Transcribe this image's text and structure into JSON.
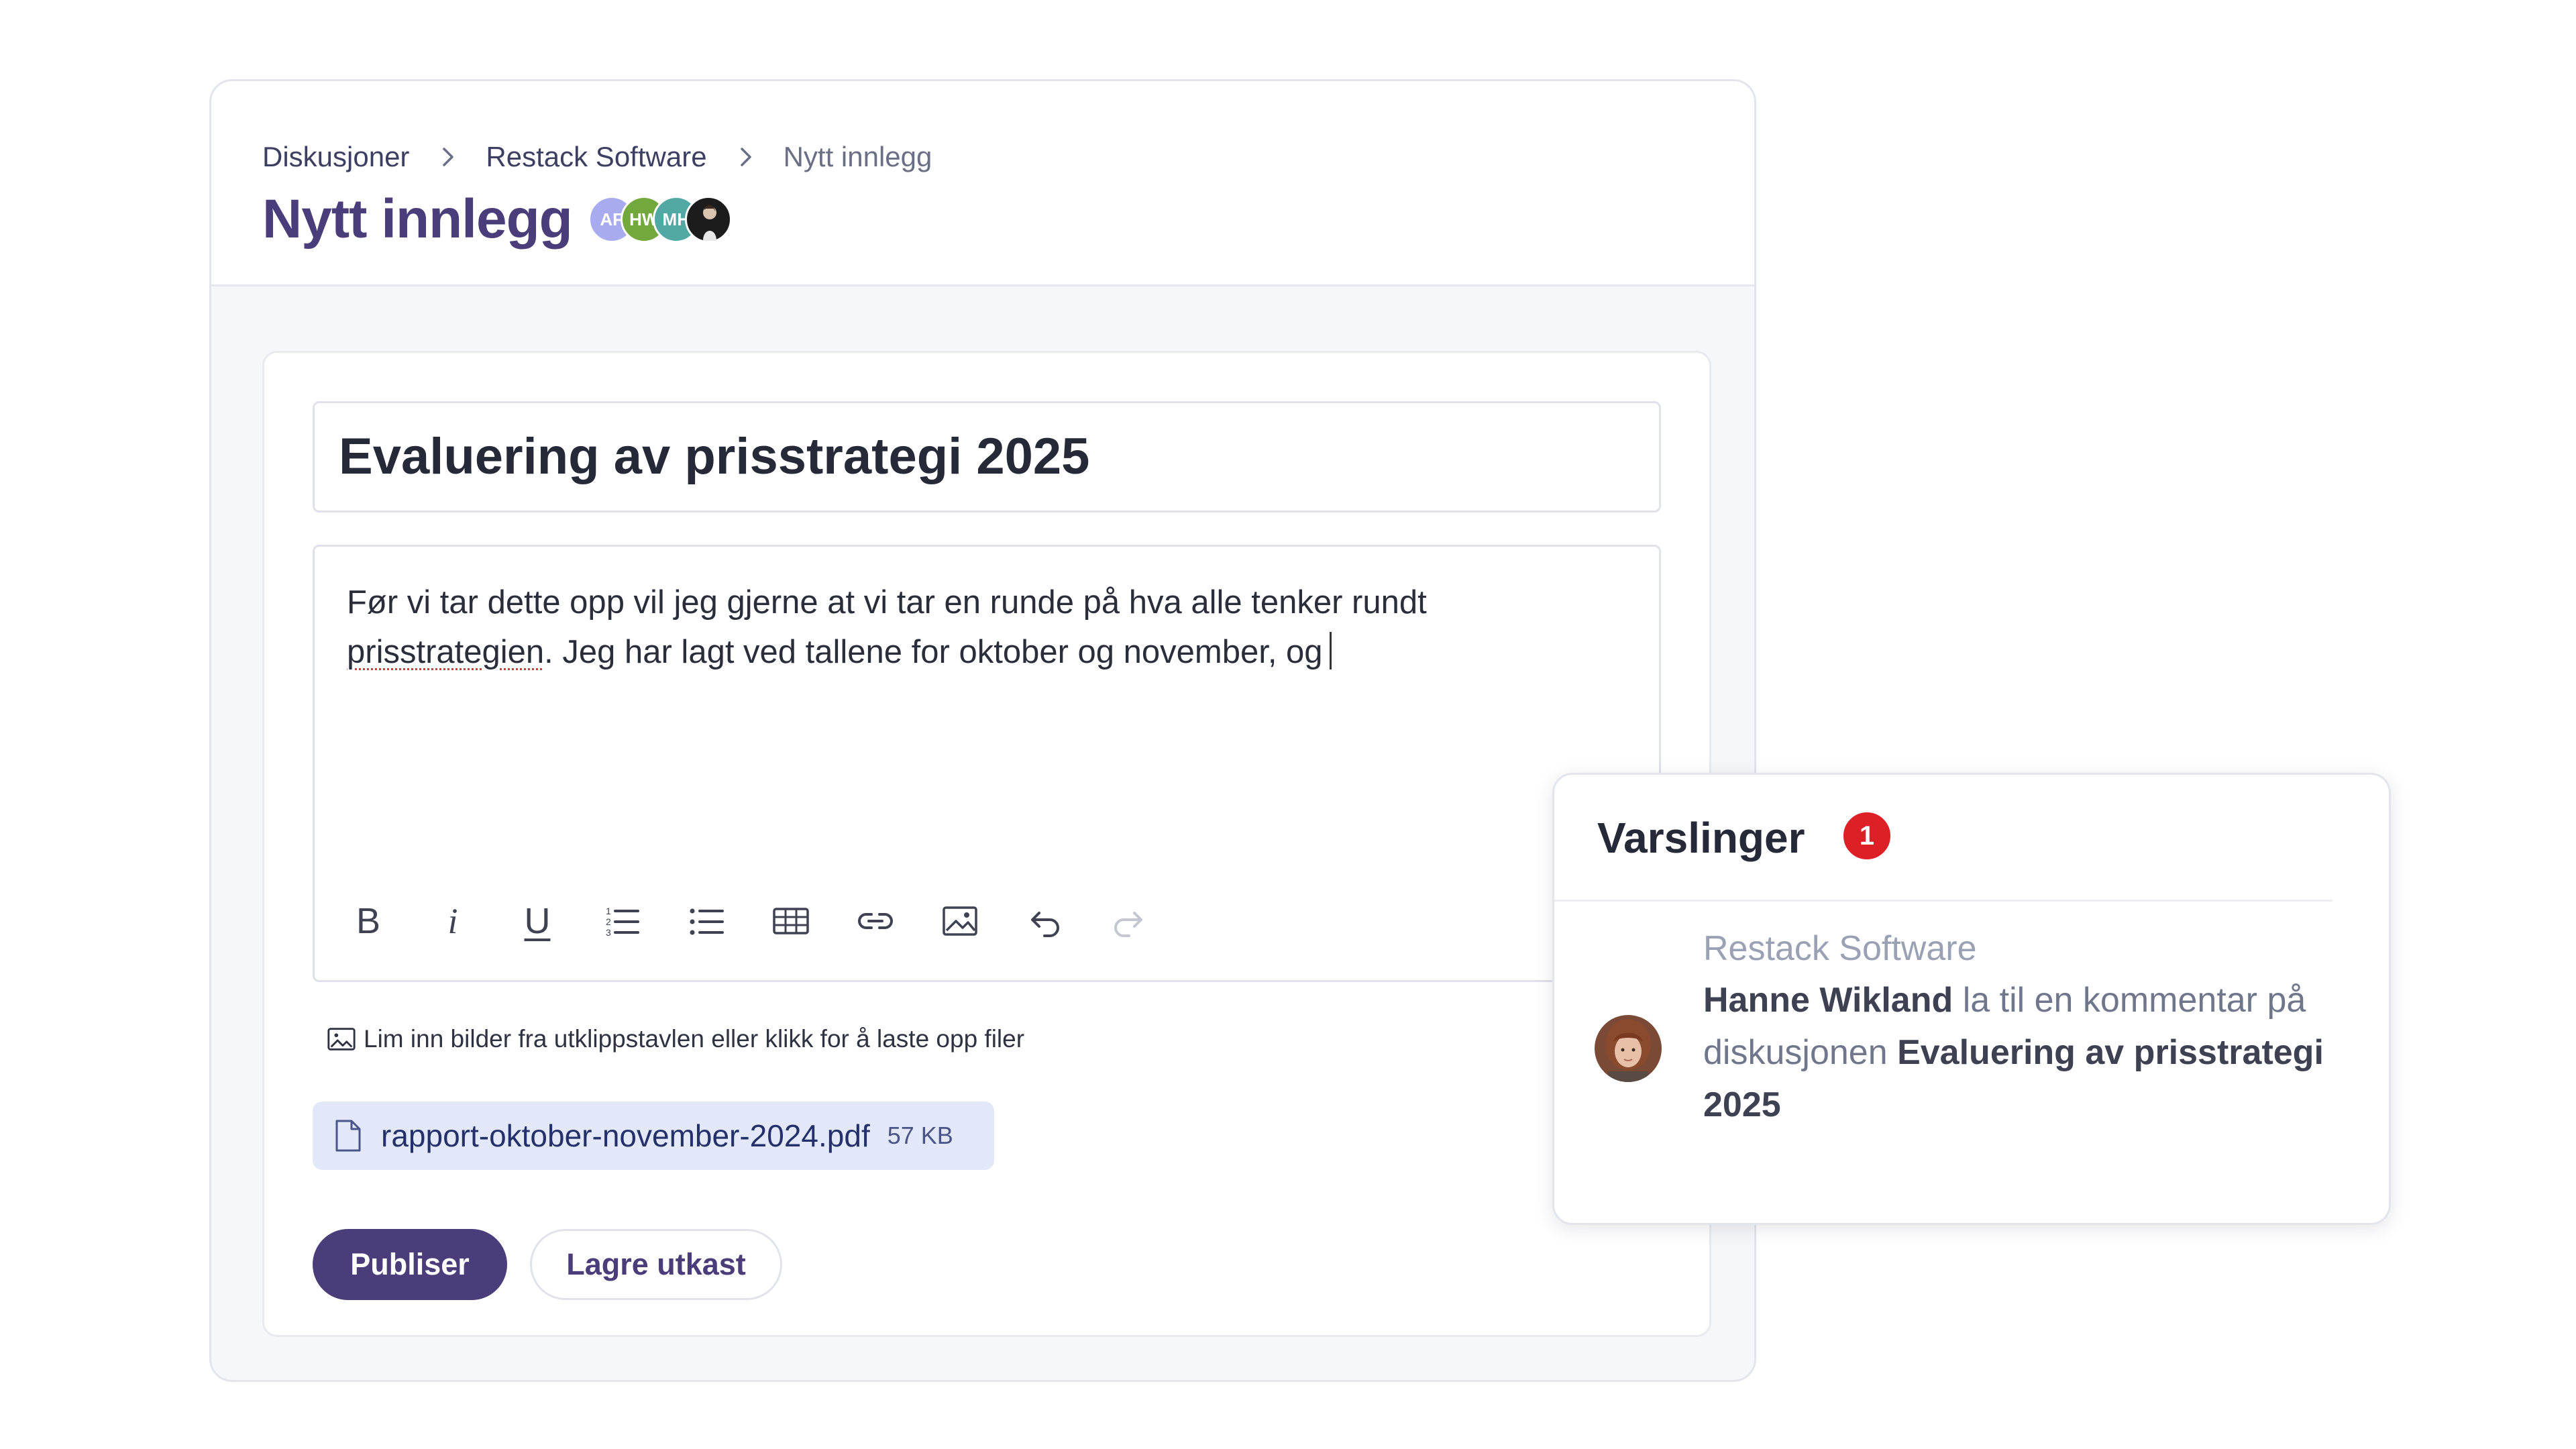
{
  "breadcrumb": {
    "items": [
      "Diskusjoner",
      "Restack Software",
      "Nytt innlegg"
    ]
  },
  "header": {
    "title": "Nytt innlegg",
    "avatars": [
      {
        "initials": "AF",
        "color": "#a8abf0"
      },
      {
        "initials": "HW",
        "color": "#73a83c"
      },
      {
        "initials": "MH",
        "color": "#52a9a3"
      },
      {
        "initials": "",
        "color": "#1c1c1c"
      }
    ]
  },
  "editor": {
    "title_value": "Evaluering av prisstrategi 2025",
    "body_before": "Før vi tar dette opp vil jeg gjerne at vi tar en runde på hva alle tenker rundt ",
    "body_misspelled": "prisstrategien",
    "body_after": ". Jeg har lagt ved tallene for oktober og november, og",
    "toolbar": {
      "bold": "B",
      "italic": "i",
      "underline": "U",
      "icons": [
        "ordered-list-icon",
        "bullet-list-icon",
        "table-icon",
        "link-icon",
        "image-icon",
        "undo-icon",
        "redo-icon"
      ]
    },
    "upload_hint": "Lim inn bilder fra utklippstavlen eller klikk for å laste opp filer",
    "attachment": {
      "filename": "rapport-oktober-november-2024.pdf",
      "size": "57 KB"
    },
    "publish_label": "Publiser",
    "draft_label": "Lagre utkast"
  },
  "notifications": {
    "title": "Varslinger",
    "count": "1",
    "badge_color": "#dd1f26",
    "item": {
      "source": "Restack Software",
      "author": "Hanne Wikland",
      "action": " la til en kommentar på diskusjonen ",
      "discussion": "Evaluering av prisstrategi 2025"
    }
  },
  "colors": {
    "accent": "#4a3d7a",
    "attachment_bg": "#e2e8f8"
  }
}
